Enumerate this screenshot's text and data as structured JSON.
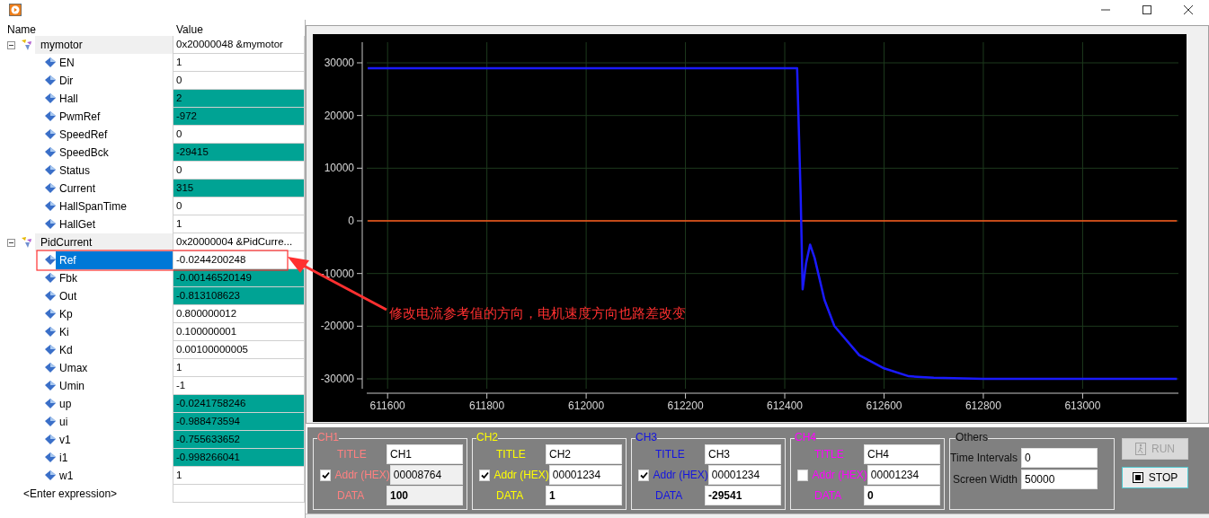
{
  "watch": {
    "columns": [
      "Name",
      "Value"
    ],
    "items": [
      {
        "name": "mymotor",
        "value": "0x20000048 &mymotor",
        "changed": false,
        "selected": false,
        "expanded": true,
        "children": [
          {
            "name": "EN",
            "value": "1",
            "changed": false,
            "selected": false
          },
          {
            "name": "Dir",
            "value": "0",
            "changed": false,
            "selected": false
          },
          {
            "name": "Hall",
            "value": "2",
            "changed": true,
            "selected": false
          },
          {
            "name": "PwmRef",
            "value": "-972",
            "changed": true,
            "selected": false
          },
          {
            "name": "SpeedRef",
            "value": "0",
            "changed": false,
            "selected": false
          },
          {
            "name": "SpeedBck",
            "value": "-29415",
            "changed": true,
            "selected": false
          },
          {
            "name": "Status",
            "value": "0",
            "changed": false,
            "selected": false
          },
          {
            "name": "Current",
            "value": "315",
            "changed": true,
            "selected": false
          },
          {
            "name": "HallSpanTime",
            "value": "0",
            "changed": false,
            "selected": false
          },
          {
            "name": "HallGet",
            "value": "1",
            "changed": false,
            "selected": false
          }
        ]
      },
      {
        "name": "PidCurrent",
        "value": "0x20000004 &PidCurre...",
        "changed": false,
        "selected": false,
        "expanded": true,
        "children": [
          {
            "name": "Ref",
            "value": "-0.0244200248",
            "changed": false,
            "selected": true
          },
          {
            "name": "Fbk",
            "value": "-0.00146520149",
            "changed": true,
            "selected": false
          },
          {
            "name": "Out",
            "value": "-0.813108623",
            "changed": true,
            "selected": false
          },
          {
            "name": "Kp",
            "value": "0.800000012",
            "changed": false,
            "selected": false
          },
          {
            "name": "Ki",
            "value": "0.100000001",
            "changed": false,
            "selected": false
          },
          {
            "name": "Kd",
            "value": "0.00100000005",
            "changed": false,
            "selected": false
          },
          {
            "name": "Umax",
            "value": "1",
            "changed": false,
            "selected": false
          },
          {
            "name": "Umin",
            "value": "-1",
            "changed": false,
            "selected": false
          },
          {
            "name": "up",
            "value": "-0.0241758246",
            "changed": true,
            "selected": false
          },
          {
            "name": "ui",
            "value": "-0.988473594",
            "changed": true,
            "selected": false
          },
          {
            "name": "v1",
            "value": "-0.755633652",
            "changed": true,
            "selected": false
          },
          {
            "name": "i1",
            "value": "-0.998266041",
            "changed": true,
            "selected": false
          },
          {
            "name": "w1",
            "value": "1",
            "changed": false,
            "selected": false
          }
        ]
      }
    ],
    "enter_expression": "<Enter expression>"
  },
  "annotation": {
    "text": "修改电流参考值的方向，电机速度方向也路差改变"
  },
  "scope": {
    "chart_data": {
      "type": "line",
      "x": [
        611560,
        611600,
        611700,
        611800,
        611900,
        612000,
        612100,
        612200,
        612300,
        612400,
        612425,
        612432,
        612436,
        612443,
        612451,
        612460,
        612480,
        612500,
        612550,
        612600,
        612650,
        612700,
        612800,
        612900,
        613000,
        613100,
        613190
      ],
      "series": [
        {
          "color": "#1a1aff",
          "values": [
            29000,
            29000,
            29000,
            29000,
            29000,
            29000,
            29000,
            29000,
            29000,
            29000,
            29000,
            5000,
            -13000,
            -8000,
            -4500,
            -7000,
            -15000,
            -20000,
            -25500,
            -28000,
            -29500,
            -29800,
            -30000,
            -30000,
            -30000,
            -30000,
            -30000
          ]
        },
        {
          "color": "#ff5a1e",
          "values": [
            0,
            0,
            0,
            0,
            0,
            0,
            0,
            0,
            0,
            0,
            0,
            0,
            0,
            0,
            0,
            0,
            0,
            0,
            0,
            0,
            0,
            0,
            0,
            0,
            0,
            0,
            0
          ]
        }
      ],
      "grid": true,
      "xlim": [
        611558,
        613193
      ],
      "ylim": [
        -31875,
        33920
      ],
      "xticks": [
        611600,
        611800,
        612000,
        612200,
        612400,
        612600,
        612800,
        613000
      ],
      "yticks": [
        -30000,
        -20000,
        -10000,
        0,
        10000,
        20000,
        30000
      ]
    }
  },
  "channels": [
    {
      "label": "CH1",
      "color": "#ff8080",
      "title_label": "TITLE",
      "title": "CH1",
      "enabled": true,
      "addr_label": "Addr (HEX)",
      "addr": "00008764",
      "readonly": true,
      "data_label": "DATA",
      "data": "100"
    },
    {
      "label": "CH2",
      "color": "#ffff00",
      "title_label": "TITLE",
      "title": "CH2",
      "enabled": true,
      "addr_label": "Addr (HEX)",
      "addr": "00001234",
      "readonly": false,
      "data_label": "DATA",
      "data": "1"
    },
    {
      "label": "CH3",
      "color": "#1414e0",
      "title_label": "TITLE",
      "title": "CH3",
      "enabled": true,
      "addr_label": "Addr (HEX)",
      "addr": "00001234",
      "readonly": false,
      "data_label": "DATA",
      "data": "-29541"
    },
    {
      "label": "CH4",
      "color": "#ff00ff",
      "title_label": "TITLE",
      "title": "CH4",
      "enabled": false,
      "addr_label": "Addr (HEX)",
      "addr": "00001234",
      "readonly": false,
      "data_label": "DATA",
      "data": "0"
    }
  ],
  "others": {
    "label": "Others",
    "fields": [
      {
        "label": "Time Intervals",
        "value": "0"
      },
      {
        "label": "Screen Width",
        "value": "50000"
      }
    ]
  },
  "buttons": [
    {
      "kind": "run",
      "label": "RUN",
      "disabled": true
    },
    {
      "kind": "stop",
      "label": "STOP",
      "disabled": false
    }
  ]
}
